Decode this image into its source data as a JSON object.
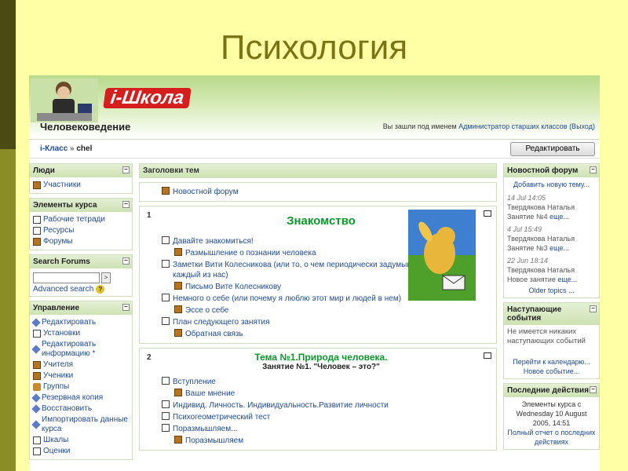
{
  "slide_title": "Психология",
  "header": {
    "logo_text": "i-Школа",
    "course_title": "Человековедение",
    "login_prefix": "Вы зашли под именем ",
    "login_user": "Администратор старших классов",
    "login_exit": "(Выход)"
  },
  "breadcrumb": {
    "home": "i-Класс",
    "sep": "»",
    "current": "chel"
  },
  "edit_button": "Редактировать",
  "left": {
    "people": {
      "title": "Люди",
      "items": [
        "Участники"
      ]
    },
    "elements": {
      "title": "Элементы курса",
      "items": [
        "Рабочие тетради",
        "Ресурсы",
        "Форумы"
      ]
    },
    "search": {
      "title": "Search Forums",
      "go": ">",
      "advanced": "Advanced search",
      "help": "?"
    },
    "admin": {
      "title": "Управление",
      "items": [
        "Редактировать",
        "Установки",
        "Редактировать информацию *",
        "Учителя",
        "Ученики",
        "Группы",
        "Резервная копия",
        "Восстановить",
        "Импортировать данные курса",
        "Шкалы",
        "Оценки"
      ]
    }
  },
  "main": {
    "head": "Заголовки тем",
    "news_forum": "Новостной форум",
    "sections": [
      {
        "num": "1",
        "title": "Знакомство",
        "links": [
          "Давайте знакомиться!",
          "Размышление о познании человека",
          "Заметки Вити Колесникова (или то, о чем периодически задумывается каждый из нас)",
          "Письмо Вите Колесникову",
          "Немного о себе (или почему я люблю этот мир и людей в нем)",
          "Эссе о себе",
          "План следующего занятия",
          "Обратная связь"
        ]
      },
      {
        "num": "2",
        "title": "Тема №1.Природа человека.",
        "subtitle": "Занятие №1. \"Человек – это?\"",
        "links": [
          "Вступление",
          "Ваше мнение",
          "Индивид. Личность. Индивидуальность.Развитие личности",
          "Психогеометрический тест",
          "Поразмышляем...",
          "Поразмышляем"
        ]
      }
    ]
  },
  "right": {
    "forum": {
      "title": "Новостной форум",
      "add": "Добавить новую тему...",
      "posts": [
        {
          "date": "14 Jul 14:05",
          "author": "Твердякова Наталья",
          "text": "Занятие №4 ",
          "more": "еще..."
        },
        {
          "date": "4 Jul 15:49",
          "author": "Твердякова Наталья",
          "text": "Занятие №3 ",
          "more": "еще..."
        },
        {
          "date": "22 Jun 18:14",
          "author": "Твердякова Наталья",
          "text": "Новое занятие ",
          "more": "еще..."
        }
      ],
      "older": "Older topics ..."
    },
    "events": {
      "title": "Наступающие события",
      "none": "Не имеется никаких наступающих событий",
      "calendar": "Перейти к календарю...",
      "new_event": "Новое событие..."
    },
    "recent": {
      "title": "Последние действия",
      "since": "Элементы курса с Wednesday 10 August 2005, 14:51",
      "full": "Полный отчет о последних действиях"
    }
  }
}
